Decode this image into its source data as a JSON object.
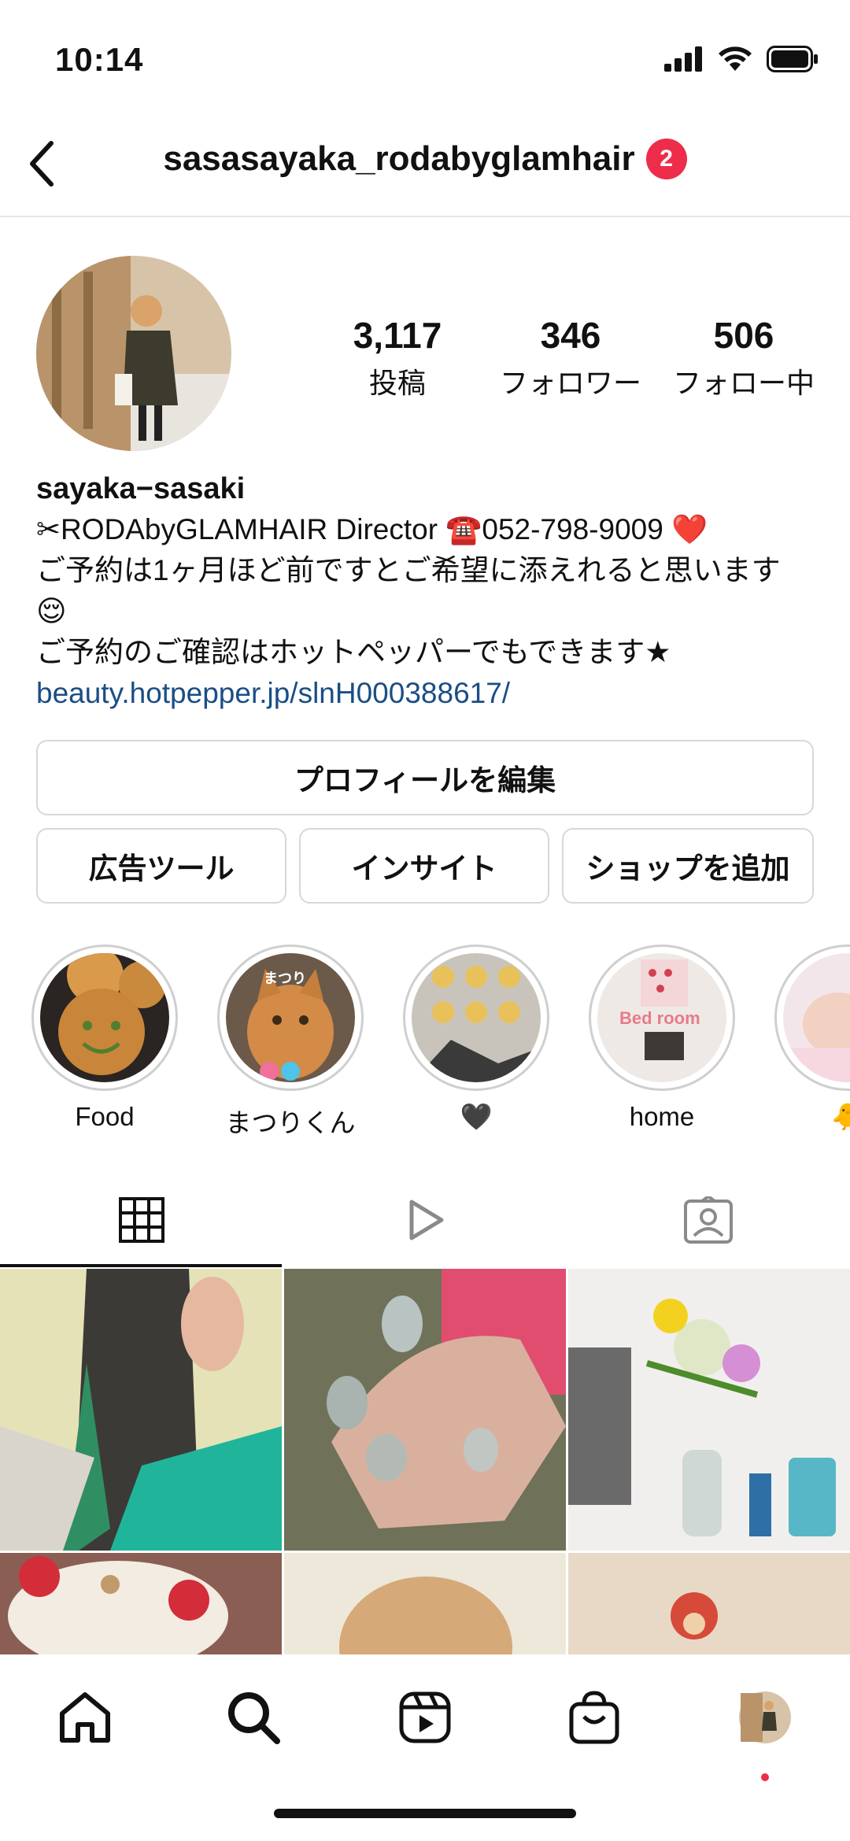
{
  "status_bar": {
    "time": "10:14"
  },
  "header": {
    "username": "sasasayaka_rodabyglamhair",
    "badge_count": "2"
  },
  "profile": {
    "stats": [
      {
        "value": "3,117",
        "label": "投稿"
      },
      {
        "value": "346",
        "label": "フォロワー"
      },
      {
        "value": "506",
        "label": "フォロー中"
      }
    ],
    "name": "sayaka−sasaki",
    "bio_lines": [
      "✂︎RODAbyGLAMHAIR Director ☎️052-798-9009 ❤️",
      "ご予約は1ヶ月ほど前ですとご希望に添えれると思います",
      "😌",
      "ご予約のご確認はホットペッパーでもできます★"
    ],
    "link": "beauty.hotpepper.jp/slnH000388617/"
  },
  "buttons": {
    "edit_profile": "プロフィールを編集",
    "ad_tools": "広告ツール",
    "insights": "インサイト",
    "add_shop": "ショップを追加"
  },
  "highlights": [
    {
      "label": "Food"
    },
    {
      "label": "まつりくん"
    },
    {
      "label": "🖤"
    },
    {
      "label": "home"
    },
    {
      "label": "🐥"
    }
  ],
  "highlight_overlay_texts": {
    "cat": "まつり",
    "room": "Bed room"
  },
  "tabs": {
    "active": "grid",
    "icons": [
      "grid-icon",
      "reels-icon",
      "tagged-icon"
    ]
  },
  "bottom_nav": {
    "icons": [
      "home-icon",
      "search-icon",
      "reels-icon",
      "shop-icon",
      "profile-icon"
    ]
  },
  "colors": {
    "badge": "#ee2d4b",
    "link": "#1a4e85",
    "notification_dot": "#ee2d4b"
  }
}
